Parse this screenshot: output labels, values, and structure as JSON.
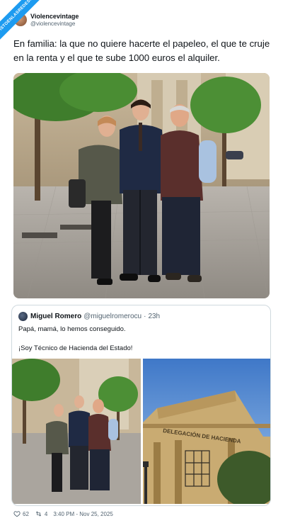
{
  "watermark": {
    "text": "VISTOENLASREDES.COM"
  },
  "author": {
    "display_name": "Violencevintage",
    "handle": "@violencevintage"
  },
  "tweet": {
    "text": "En familia: la que no quiere hacerte el papeleo, el que te cruje en la renta y el que te sube 1000 euros el alquiler."
  },
  "quoted": {
    "display_name": "Miguel Romero",
    "handle": "@miguelromerocu",
    "separator": "·",
    "time": "23h",
    "line1": "Papá, mamá, lo hemos conseguido.",
    "line2": "¡Soy Técnico de Hacienda del Estado!",
    "building_sign": "DELEGACIÓN DE HACIENDA"
  },
  "stats": {
    "likes": "62",
    "retweets": "4",
    "timestamp": "3:40 PM - Nov 25, 2025"
  },
  "icons": [
    "heart-icon",
    "retweet-icon"
  ],
  "colors": {
    "accent": "#1d9bf0",
    "text": "#0f1419",
    "muted": "#536471",
    "border": "#cfd9de"
  }
}
